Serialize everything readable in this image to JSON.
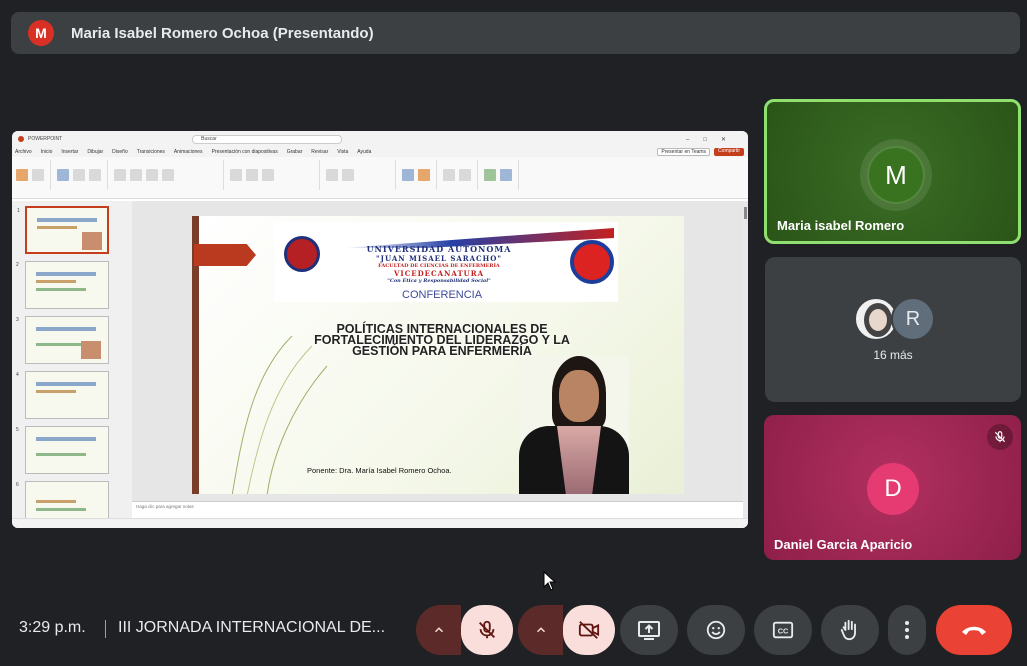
{
  "presenter_bar": {
    "avatar_letter": "M",
    "title": "Maria Isabel Romero Ochoa (Presentando)"
  },
  "shared_screen": {
    "window_title": "POWERPOINT",
    "search_placeholder": "Buscar",
    "menu": [
      "Archivo",
      "Inicio",
      "Insertar",
      "Dibujar",
      "Diseño",
      "Transiciones",
      "Animaciones",
      "Presentación con diapositivas",
      "Grabar",
      "Revisar",
      "Vista",
      "Ayuda"
    ],
    "present_button": "Presentar en Teams",
    "share_button": "Compartir",
    "notes_placeholder": "Haga clic para agregar notas",
    "slide": {
      "university_line1": "UNIVERSIDAD AUTÓNOMA",
      "university_line2": "\"JUAN MISAEL SARACHO\"",
      "faculty": "FACULTAD DE CIENCIAS DE ENFERMERÍA",
      "office": "VICEDECANATURA",
      "motto": "\"Con Ética y Responsabilidad Social\"",
      "event": "CONFERENCIA",
      "title": "POLÍTICAS INTERNACIONALES DE FORTALECIMIENTO DEL LIDERAZGO Y LA GESTIÓN PARA ENFERMERÍA",
      "speaker": "Ponente: Dra. María Isabel Romero Ochoa."
    },
    "thumbnail_numbers": [
      "1",
      "2",
      "3",
      "4",
      "5",
      "6"
    ]
  },
  "tiles": {
    "speaker": {
      "avatar_letter": "M",
      "name": "Maria isabel Romero",
      "accent": "#8fe06f"
    },
    "others": {
      "avatar_letter": "R",
      "more_label": "16 más"
    },
    "participant": {
      "avatar_letter": "D",
      "name": "Daniel Garcia Aparicio",
      "accent": "#e63a72"
    }
  },
  "bottom_bar": {
    "time": "3:29 p.m.",
    "meeting_title": "III JORNADA INTERNACIONAL DE...",
    "controls": [
      "mic-caret",
      "mic-off",
      "camera-caret",
      "camera-off",
      "present-screen",
      "emoji",
      "captions",
      "raise-hand",
      "more-options",
      "end-call"
    ],
    "end_call_color": "#ea4335"
  }
}
